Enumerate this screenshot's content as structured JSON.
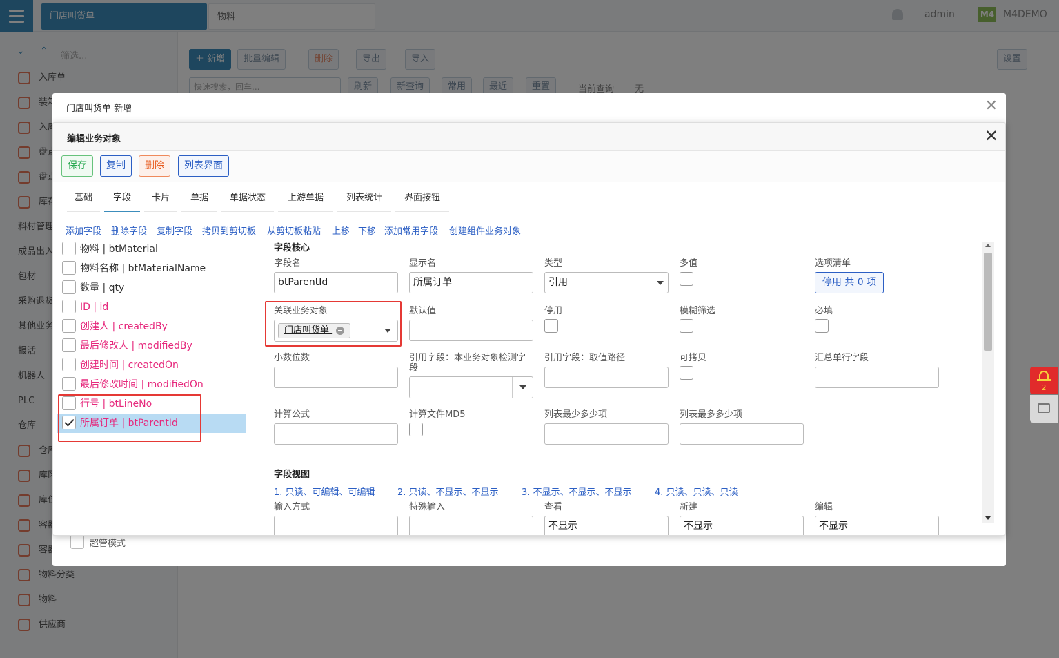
{
  "topbar": {
    "tabs": [
      "门店叫货单",
      "物料"
    ],
    "user": "admin",
    "brand_mark": "M4",
    "brand": "M4DEMO"
  },
  "sidebar": {
    "filter_placeholder": "筛选...",
    "items": [
      {
        "label": "入库单",
        "icon": "doc"
      },
      {
        "label": "装箱",
        "icon": "doc"
      },
      {
        "label": "入库",
        "icon": "doc"
      },
      {
        "label": "盘点",
        "icon": "doc"
      },
      {
        "label": "盘点",
        "icon": "doc"
      },
      {
        "label": "库存",
        "icon": "doc"
      },
      {
        "label": "料村管理",
        "icon": "none"
      },
      {
        "label": "成品出入",
        "icon": "none"
      },
      {
        "label": "包材",
        "icon": "none"
      },
      {
        "label": "采购退货",
        "icon": "none"
      },
      {
        "label": "其他业务",
        "icon": "none"
      },
      {
        "label": "报活",
        "icon": "none"
      },
      {
        "label": "机器人",
        "icon": "none"
      },
      {
        "label": "PLC",
        "icon": "none"
      },
      {
        "label": "仓库",
        "icon": "none"
      },
      {
        "label": "仓库",
        "icon": "doc"
      },
      {
        "label": "库区",
        "icon": "doc"
      },
      {
        "label": "库位",
        "icon": "doc"
      },
      {
        "label": "容器",
        "icon": "doc"
      },
      {
        "label": "容器",
        "icon": "doc"
      },
      {
        "label": "物料分类",
        "icon": "doc"
      },
      {
        "label": "物料",
        "icon": "doc"
      },
      {
        "label": "供应商",
        "icon": "doc"
      }
    ],
    "super_mode": "超管模式"
  },
  "toolbar": {
    "new": "新增",
    "batch_edit": "批量编辑",
    "delete": "删除",
    "export": "导出",
    "import": "导入",
    "settings": "设置",
    "quick_search_placeholder": "快速搜索，回车...",
    "refresh": "刷新",
    "new_query": "新查询",
    "common": "常用",
    "recent": "最近",
    "reset": "重置",
    "current_query_label": "当前查询",
    "current_query_value": "无"
  },
  "outer_modal": {
    "title": "门店叫货单 新增"
  },
  "inner_modal": {
    "title": "编辑业务对象",
    "actions": {
      "save": "保存",
      "copy": "复制",
      "delete": "删除",
      "list_ui": "列表界面"
    },
    "tabs": [
      "基础",
      "字段",
      "卡片",
      "单据",
      "单据状态",
      "上游单据",
      "列表统计",
      "界面按钮"
    ],
    "active_tab": "字段",
    "field_actions": [
      "添加字段",
      "删除字段",
      "复制字段",
      "拷贝到剪切板",
      "从剪切板粘贴",
      "上移",
      "下移",
      "添加常用字段",
      "创建组件业务对象"
    ],
    "fields": [
      {
        "label": "物料 | btMaterial",
        "color": "black",
        "checked": false
      },
      {
        "label": "物料名称 | btMaterialName",
        "color": "black",
        "checked": false
      },
      {
        "label": "数量 | qty",
        "color": "black",
        "checked": false
      },
      {
        "label": "ID | id",
        "color": "pink",
        "checked": false
      },
      {
        "label": "创建人 | createdBy",
        "color": "pink",
        "checked": false
      },
      {
        "label": "最后修改人 | modifiedBy",
        "color": "pink",
        "checked": false
      },
      {
        "label": "创建时间 | createdOn",
        "color": "pink",
        "checked": false
      },
      {
        "label": "最后修改时间 | modifiedOn",
        "color": "pink",
        "checked": false
      },
      {
        "label": "行号 | btLineNo",
        "color": "pink",
        "checked": false
      },
      {
        "label": "所属订单 | btParentId",
        "color": "pink",
        "checked": true
      }
    ],
    "core": {
      "section_title": "字段核心",
      "field_name_label": "字段名",
      "field_name_value": "btParentId",
      "display_name_label": "显示名",
      "display_name_value": "所属订单",
      "type_label": "类型",
      "type_value": "引用",
      "multi_value_label": "多值",
      "options_label": "选项清单",
      "options_button": "停用 共 0 项",
      "ref_object_label": "关联业务对象",
      "ref_object_tag": "门店叫货单",
      "default_label": "默认值",
      "disabled_label": "停用",
      "fuzzy_label": "模糊筛选",
      "required_label": "必填",
      "decimals_label": "小数位数",
      "ref_field_check_label": "引用字段：本业务对象检测字段",
      "ref_field_path_label": "引用字段：取值路径",
      "copyable_label": "可拷贝",
      "summary_label": "汇总单行字段",
      "formula_label": "计算公式",
      "md5_label": "计算文件MD5",
      "list_min_label": "列表最少多少项",
      "list_max_label": "列表最多多少项"
    },
    "view": {
      "section_title": "字段视图",
      "presets": [
        "1. 只读、可编辑、可编辑",
        "2. 只读、不显示、不显示",
        "3. 不显示、不显示、不显示",
        "4. 只读、只读、只读"
      ],
      "input_mode_label": "输入方式",
      "special_input_label": "特殊输入",
      "view_label": "查看",
      "new_label": "新建",
      "edit_label": "编辑",
      "view_value": "不显示",
      "new_value": "不显示",
      "edit_value": "不显示"
    }
  },
  "floating": {
    "alarm_count": "2"
  }
}
